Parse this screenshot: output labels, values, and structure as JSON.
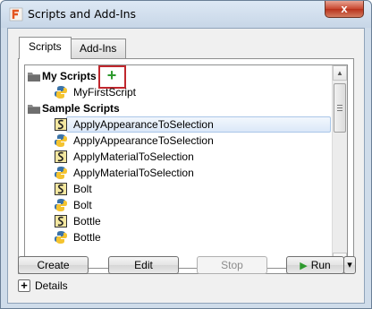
{
  "window": {
    "title": "Scripts and Add-Ins",
    "close_glyph": "x"
  },
  "tabs": [
    {
      "label": "Scripts",
      "active": true
    },
    {
      "label": "Add-Ins",
      "active": false
    }
  ],
  "tree": {
    "groups": [
      {
        "label": "My Scripts",
        "add_glyph": "+",
        "items": [
          {
            "label": "MyFirstScript",
            "icon": "python-icon"
          }
        ]
      },
      {
        "label": "Sample Scripts",
        "items": [
          {
            "label": "ApplyAppearanceToSelection",
            "icon": "js-script-icon",
            "selected": true
          },
          {
            "label": "ApplyAppearanceToSelection",
            "icon": "python-icon"
          },
          {
            "label": "ApplyMaterialToSelection",
            "icon": "js-script-icon"
          },
          {
            "label": "ApplyMaterialToSelection",
            "icon": "python-icon"
          },
          {
            "label": "Bolt",
            "icon": "js-script-icon"
          },
          {
            "label": "Bolt",
            "icon": "python-icon"
          },
          {
            "label": "Bottle",
            "icon": "js-script-icon"
          },
          {
            "label": "Bottle",
            "icon": "python-icon"
          }
        ]
      }
    ]
  },
  "buttons": {
    "create": "Create",
    "edit": "Edit",
    "stop": "Stop",
    "run": "Run",
    "run_glyph": "▶",
    "dropdown_glyph": "▾"
  },
  "details": {
    "label": "Details",
    "toggle_glyph": "+"
  },
  "colors": {
    "accent_green": "#2e9a2e",
    "highlight_red": "#c0272d",
    "selection": "#dbe8f8"
  }
}
